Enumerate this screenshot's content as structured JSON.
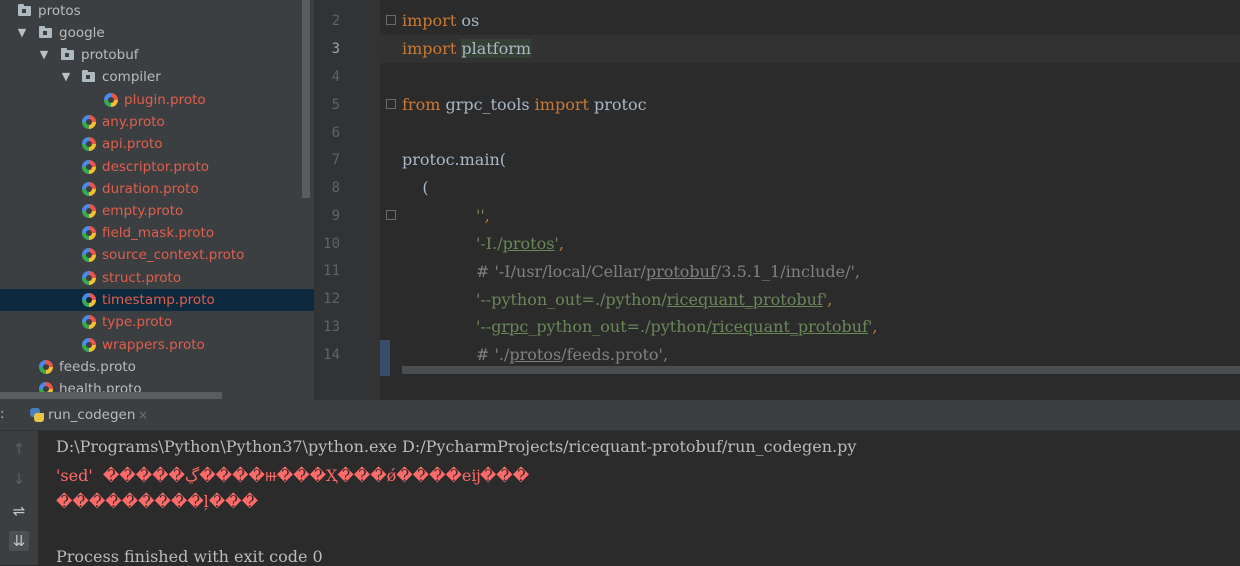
{
  "project_tree": {
    "items": [
      {
        "label": "protos",
        "type": "folder",
        "level": 0,
        "expanded": true
      },
      {
        "label": "google",
        "type": "folder",
        "level": 1,
        "expanded": true
      },
      {
        "label": "protobuf",
        "type": "folder",
        "level": 2,
        "expanded": true
      },
      {
        "label": "compiler",
        "type": "folder",
        "level": 3,
        "expanded": true
      },
      {
        "label": "plugin.proto",
        "type": "file",
        "level": 4
      },
      {
        "label": "any.proto",
        "type": "file",
        "level": 3
      },
      {
        "label": "api.proto",
        "type": "file",
        "level": 3
      },
      {
        "label": "descriptor.proto",
        "type": "file",
        "level": 3
      },
      {
        "label": "duration.proto",
        "type": "file",
        "level": 3
      },
      {
        "label": "empty.proto",
        "type": "file",
        "level": 3
      },
      {
        "label": "field_mask.proto",
        "type": "file",
        "level": 3
      },
      {
        "label": "source_context.proto",
        "type": "file",
        "level": 3
      },
      {
        "label": "struct.proto",
        "type": "file",
        "level": 3
      },
      {
        "label": "timestamp.proto",
        "type": "file",
        "level": 3,
        "selected": true
      },
      {
        "label": "type.proto",
        "type": "file",
        "level": 3
      },
      {
        "label": "wrappers.proto",
        "type": "file",
        "level": 3
      },
      {
        "label": "feeds.proto",
        "type": "file",
        "level": 1
      },
      {
        "label": "health.proto",
        "type": "file",
        "level": 1
      }
    ]
  },
  "editor": {
    "line_numbers": [
      "2",
      "3",
      "4",
      "5",
      "6",
      "7",
      "8",
      "9",
      "10",
      "11",
      "12",
      "13",
      "14"
    ],
    "current_line": "3",
    "lines": {
      "l2_kw": "import",
      "l2_rest": " os",
      "l3_kw": "import",
      "l3_rest": "platform",
      "l5_kw1": "from",
      "l5_mid": " grpc_tools ",
      "l5_kw2": "import",
      "l5_rest": " protoc",
      "l7": "protoc.main(",
      "l8": "    (",
      "l9_str": "''",
      "l9_comma": ",",
      "l10_a": "'-I./",
      "l10_u": "protos",
      "l10_b": "'",
      "l10_comma": ",",
      "l11_a": "# '-I/usr/local/Cellar/",
      "l11_u": "protobuf",
      "l11_b": "/3.5.1_1/include/',",
      "l12_a": "'--python_out=./python/",
      "l12_u": "ricequant_protobuf",
      "l12_b": "'",
      "l12_comma": ",",
      "l13_a": "'--",
      "l13_u1": "grpc",
      "l13_m": "_python_out=./python/",
      "l13_u2": "ricequant_protobuf",
      "l13_b": "'",
      "l13_comma": ",",
      "l14_a": "# './",
      "l14_u": "protos",
      "l14_b": "/feeds.proto',"
    }
  },
  "run_panel": {
    "colon": ":",
    "tab_label": "run_codegen",
    "tab_close": "×",
    "toolbar": {
      "up": "↑",
      "down": "↓",
      "wrap": "⇌",
      "scroll": "⇊"
    },
    "console_lines": {
      "command": "D:\\Programs\\Python\\Python37\\python.exe D:/PycharmProjects/ricequant-protobuf/run_codegen.py",
      "error1": "'sed'  �����ڲ����ⲿ���Ҳ���ǿ����еĳ���",
      "error2": "���������ļ���",
      "finished": "Process finished with exit code 0"
    }
  },
  "colors": {
    "keyword": "#cc7832",
    "string": "#6a8759",
    "comment": "#808080",
    "error": "#ff6b68",
    "file_red": "#e05e4c",
    "selection": "#0d293e"
  }
}
